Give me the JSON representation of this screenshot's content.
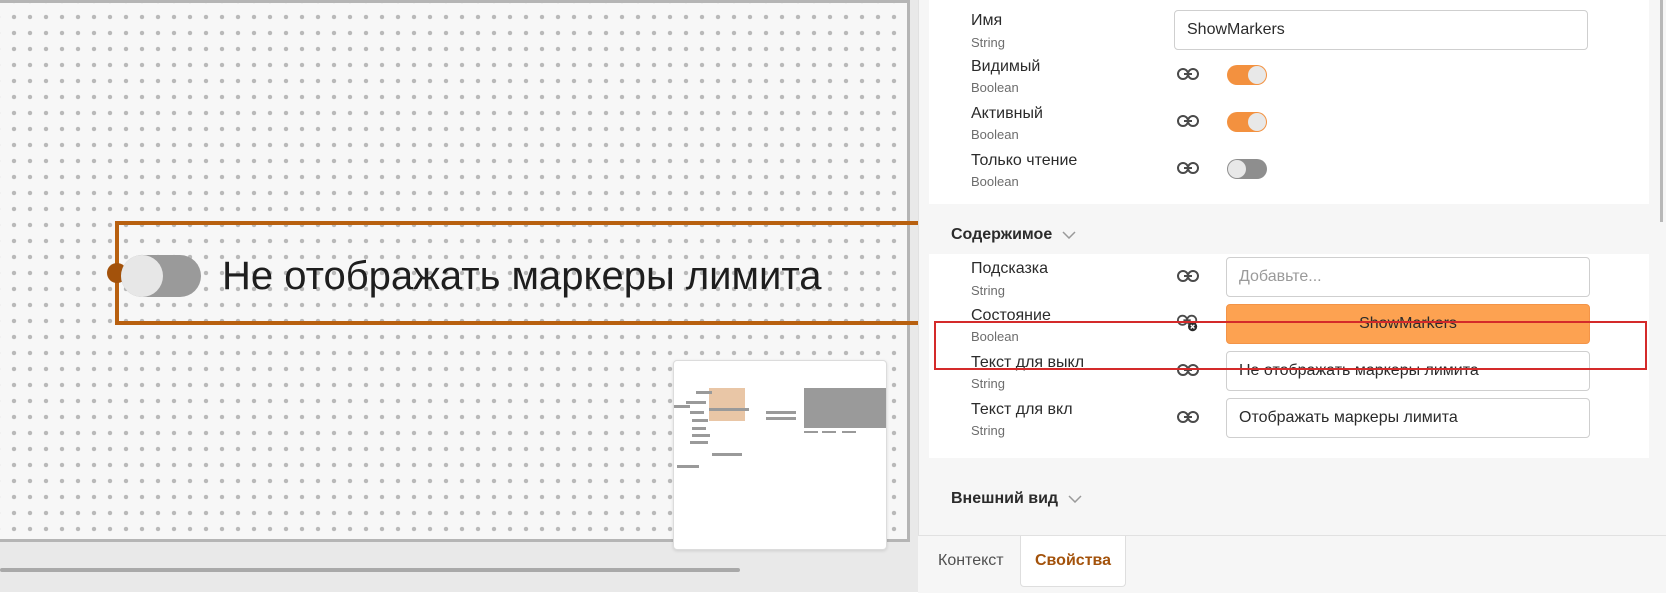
{
  "canvas": {
    "widget_label": "Не отображать маркеры лимита"
  },
  "properties": {
    "name": {
      "label": "Имя",
      "type": "String",
      "value": "ShowMarkers"
    },
    "visible": {
      "label": "Видимый",
      "type": "Boolean",
      "state": "on"
    },
    "active": {
      "label": "Активный",
      "type": "Boolean",
      "state": "on"
    },
    "readonly": {
      "label": "Только чтение",
      "type": "Boolean",
      "state": "off"
    }
  },
  "content_section": {
    "title": "Содержимое",
    "hint": {
      "label": "Подсказка",
      "type": "String",
      "placeholder": "Добавьте..."
    },
    "state": {
      "label": "Состояние",
      "type": "Boolean",
      "value": "ShowMarkers"
    },
    "text_off": {
      "label": "Текст для выкл",
      "type": "String",
      "value": "Не отображать маркеры лимита"
    },
    "text_on": {
      "label": "Текст для вкл",
      "type": "String",
      "value": "Отображать маркеры лимита"
    }
  },
  "appearance_section": {
    "title": "Внешний вид"
  },
  "tabs": [
    {
      "label": "Контекст",
      "active": false
    },
    {
      "label": "Свойства",
      "active": true
    }
  ],
  "colors": {
    "accent": "#f3913f",
    "selection": "#b8600f",
    "highlight": "#d42a2a"
  },
  "icons": {
    "link": "link-icon",
    "unlink": "unlink-icon",
    "chevron": "chevron-down-icon"
  }
}
